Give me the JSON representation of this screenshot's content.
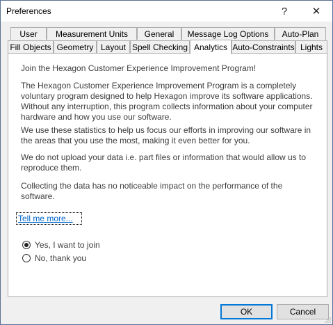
{
  "window": {
    "title": "Preferences",
    "help": "?",
    "close": "✕"
  },
  "tabs_row1": [
    {
      "label": "User"
    },
    {
      "label": "Measurement Units"
    },
    {
      "label": "General"
    },
    {
      "label": "Message Log Options"
    },
    {
      "label": "Auto-Plan"
    }
  ],
  "tabs_row2": [
    {
      "label": "Fill Objects"
    },
    {
      "label": "Geometry"
    },
    {
      "label": "Layout"
    },
    {
      "label": "Spell Checking"
    },
    {
      "label": "Analytics"
    },
    {
      "label": "Auto-Constraints"
    },
    {
      "label": "Lights"
    }
  ],
  "active_tab": "Analytics",
  "content": {
    "p1": "Join the Hexagon Customer Experience Improvement Program!",
    "p2": "The Hexagon Customer Experience Improvement Program is a completely voluntary program designed to help Hexagon improve its software applications. Without any interruption, this program collects information about your computer hardware and how you use our software.",
    "p3": "We use these statistics to help us focus our efforts in improving our software in the areas that you use the most, making it even better for you.",
    "p4": "We do not upload your data i.e. part files or information that would allow us to reproduce them.",
    "p5": "Collecting the data has no noticeable impact on the performance of the software.",
    "link": "Tell me more...",
    "radio_yes": "Yes, I want to join",
    "radio_no": "No, thank you",
    "selected": "yes"
  },
  "buttons": {
    "ok": "OK",
    "cancel": "Cancel"
  }
}
